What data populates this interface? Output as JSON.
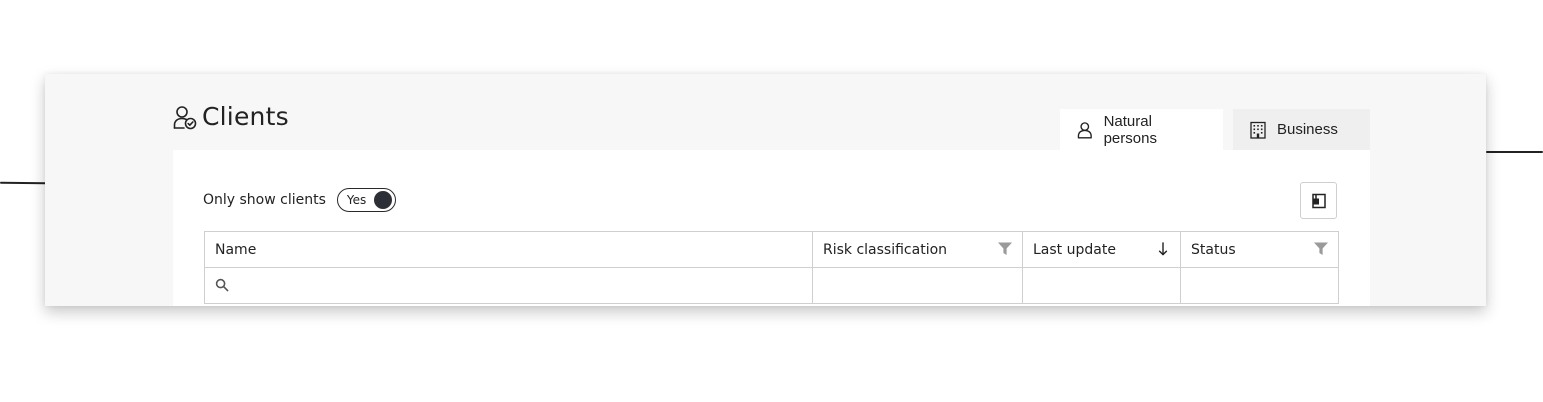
{
  "page": {
    "title": "Clients"
  },
  "tabs": [
    {
      "label": "Natural persons",
      "icon": "person-icon",
      "active": true
    },
    {
      "label": "Business",
      "icon": "building-icon",
      "active": false
    }
  ],
  "filter_toggle": {
    "label": "Only show clients",
    "value": "Yes"
  },
  "toolbar": {
    "columns_button_icon": "column-chooser-icon"
  },
  "table": {
    "columns": [
      {
        "label": "Name",
        "icon": ""
      },
      {
        "label": "Risk classification",
        "icon": "filter-icon"
      },
      {
        "label": "Last update",
        "icon": "sort-descending-icon"
      },
      {
        "label": "Status",
        "icon": "filter-icon"
      }
    ],
    "search": {
      "value": "",
      "placeholder": ""
    }
  },
  "colors": {
    "text": "#222222",
    "panel": "#ffffff",
    "background": "#f7f7f7",
    "border": "#cfcfcf",
    "filter_icon": "#9a9a9a",
    "toggle_knob": "#2d2f36"
  }
}
